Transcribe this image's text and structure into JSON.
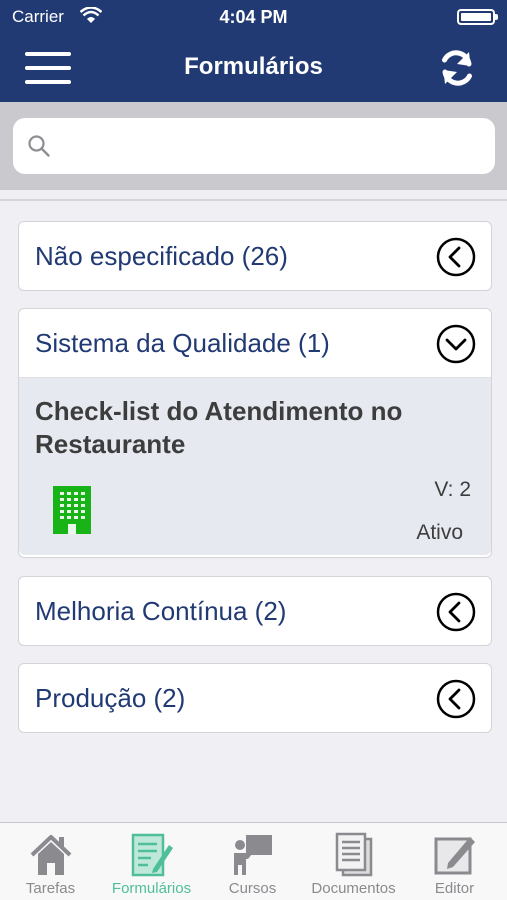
{
  "status_bar": {
    "carrier": "Carrier",
    "time": "4:04 PM"
  },
  "nav": {
    "title": "Formulários",
    "menu_icon": "hamburger-icon",
    "refresh_icon": "refresh-icon"
  },
  "search": {
    "placeholder": "",
    "value": ""
  },
  "groups": [
    {
      "label": "Não especificado  (26)",
      "expanded": false
    },
    {
      "label": "Sistema da Qualidade  (1)",
      "expanded": true,
      "items": [
        {
          "title": "Check-list do Atendimento no Restaurante",
          "version": "V:  2",
          "status": "Ativo",
          "icon": "building-icon"
        }
      ]
    },
    {
      "label": "Melhoria Contínua  (2)",
      "expanded": false
    },
    {
      "label": "Produção  (2)",
      "expanded": false
    }
  ],
  "tabs": [
    {
      "label": "Tarefas",
      "icon": "home-icon",
      "active": false
    },
    {
      "label": "Formulários",
      "icon": "form-edit-icon",
      "active": true
    },
    {
      "label": "Cursos",
      "icon": "presenter-icon",
      "active": false
    },
    {
      "label": "Documentos",
      "icon": "documents-icon",
      "active": false
    },
    {
      "label": "Editor",
      "icon": "edit-icon",
      "active": false
    }
  ],
  "colors": {
    "nav": "#213a74",
    "accent": "#4fbf9a",
    "building": "#17b317"
  }
}
